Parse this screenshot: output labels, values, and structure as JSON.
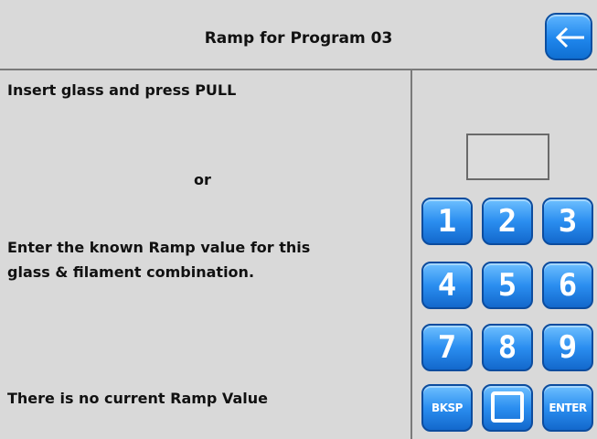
{
  "header": {
    "title": "Ramp for Program 03",
    "back_icon": "back-arrow-icon"
  },
  "instructions": {
    "line1": "Insert glass and press PULL",
    "or": "or",
    "line2a": "Enter the known Ramp value for this",
    "line2b": "glass & filament combination.",
    "status": "There is no current Ramp Value"
  },
  "entry": {
    "value": ""
  },
  "keypad": {
    "k1": "1",
    "k2": "2",
    "k3": "3",
    "k4": "4",
    "k5": "5",
    "k6": "6",
    "k7": "7",
    "k8": "8",
    "k9": "9",
    "bksp": "BKSP",
    "enter": "ENTER"
  },
  "colors": {
    "button_blue": "#2b8ef0",
    "background": "#d9d9d9"
  }
}
